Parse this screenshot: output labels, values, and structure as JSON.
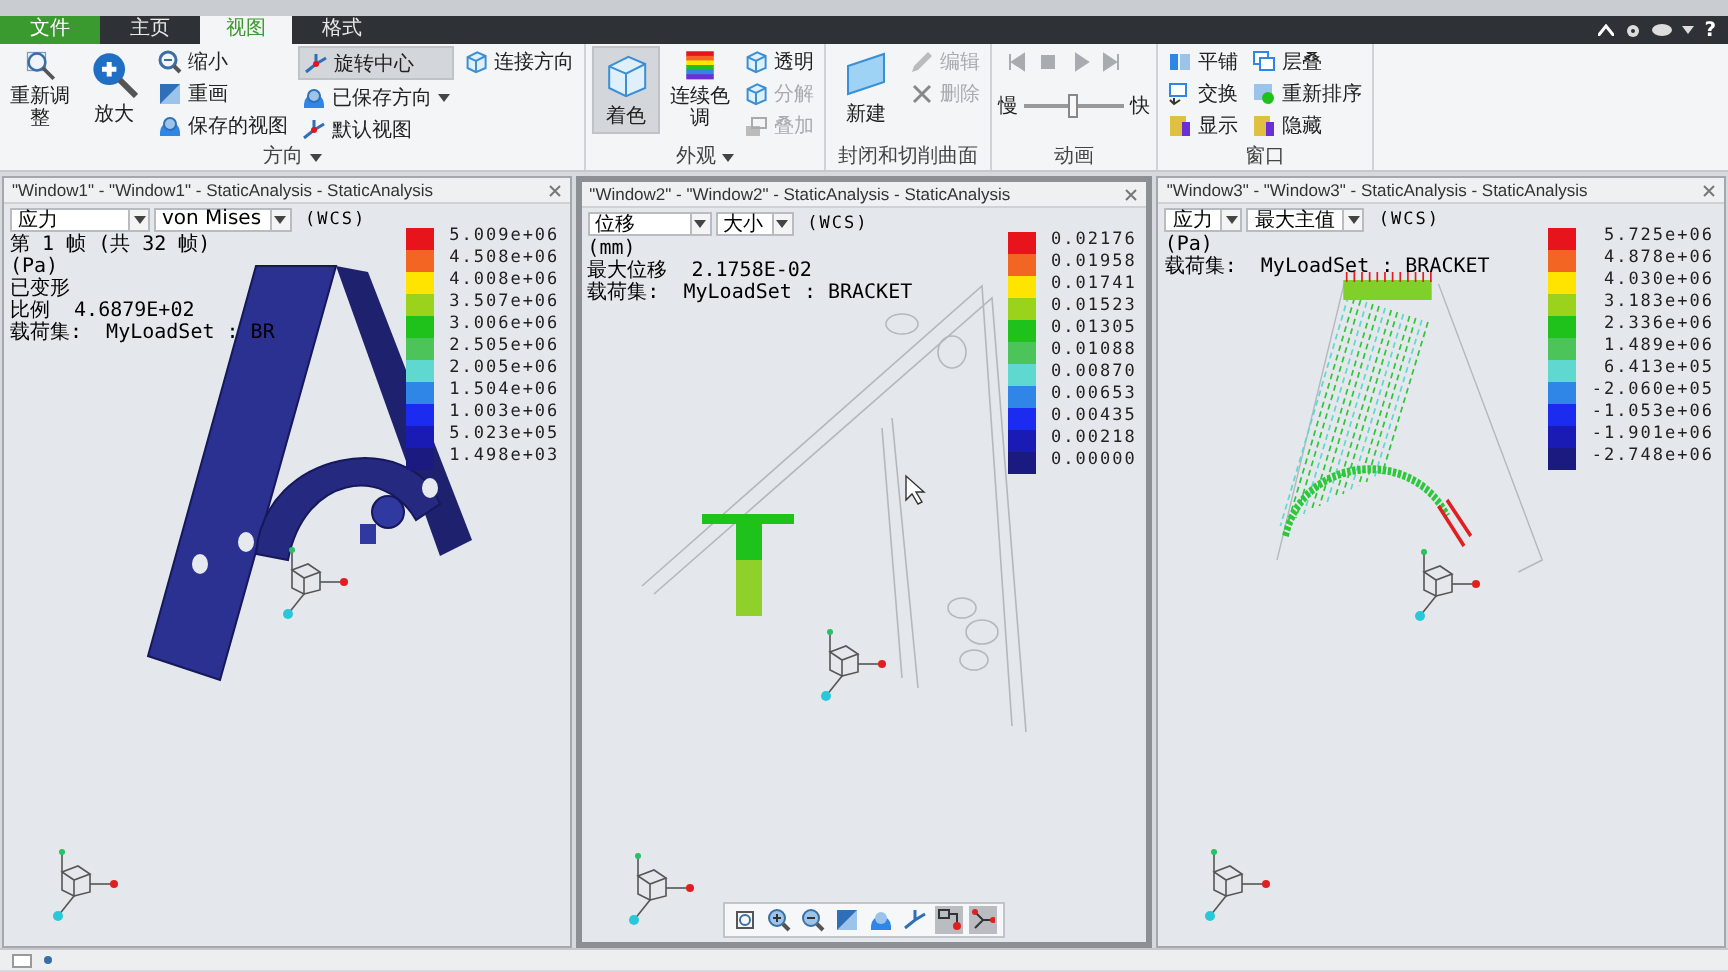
{
  "ribbon": {
    "tabs": [
      {
        "label": "文件",
        "kind": "file",
        "selected": false
      },
      {
        "label": "主页",
        "kind": "normal",
        "selected": false
      },
      {
        "label": "视图",
        "kind": "normal",
        "selected": true
      },
      {
        "label": "格式",
        "kind": "normal",
        "selected": false
      }
    ],
    "help": "?",
    "groups": [
      {
        "label": "方向",
        "has_menu": true,
        "columns": [
          [
            {
              "kind": "large",
              "label": "重新调整",
              "disabled": false,
              "selected": false
            }
          ],
          [
            {
              "kind": "large",
              "label": "放大",
              "disabled": false,
              "selected": false
            }
          ],
          [
            {
              "kind": "small",
              "label": "缩小",
              "disabled": false,
              "selected": false
            },
            {
              "kind": "small",
              "label": "重画",
              "disabled": false,
              "selected": false
            },
            {
              "kind": "small",
              "label": "保存的视图",
              "disabled": false,
              "selected": false
            }
          ],
          [
            {
              "kind": "small",
              "label": "旋转中心",
              "disabled": false,
              "selected": true
            },
            {
              "kind": "small",
              "label": "已保存方向",
              "disabled": false,
              "selected": false,
              "has_menu": true
            },
            {
              "kind": "small",
              "label": "默认视图",
              "disabled": false,
              "selected": false
            }
          ],
          [
            {
              "kind": "small",
              "label": "连接方向",
              "disabled": false,
              "selected": false
            }
          ]
        ]
      },
      {
        "label": "外观",
        "has_menu": true,
        "columns": [
          [
            {
              "kind": "large",
              "label": "着色",
              "disabled": false,
              "selected": true
            }
          ],
          [
            {
              "kind": "large",
              "label": "连续色调",
              "disabled": false,
              "selected": false
            }
          ],
          [
            {
              "kind": "small",
              "label": "透明",
              "disabled": false,
              "selected": false
            },
            {
              "kind": "small",
              "label": "分解",
              "disabled": true,
              "selected": false
            },
            {
              "kind": "small",
              "label": "叠加",
              "disabled": true,
              "selected": false
            }
          ]
        ]
      },
      {
        "label": "封闭和切削曲面",
        "has_menu": false,
        "columns": [
          [
            {
              "kind": "large",
              "label": "新建",
              "disabled": false,
              "selected": false
            }
          ],
          [
            {
              "kind": "small",
              "label": "编辑",
              "disabled": true,
              "selected": false
            },
            {
              "kind": "small",
              "label": "删除",
              "disabled": true,
              "selected": false
            }
          ]
        ]
      },
      {
        "label": "动画",
        "has_menu": false,
        "columns": [
          [
            {
              "kind": "playback",
              "buttons": [
                {
                  "disabled": true
                },
                {
                  "disabled": true
                },
                {
                  "disabled": true
                },
                {
                  "disabled": true
                }
              ]
            },
            {
              "kind": "slider",
              "min_label": "慢",
              "max_label": "快",
              "level": 0.5
            }
          ]
        ]
      },
      {
        "label": "窗口",
        "has_menu": false,
        "columns": [
          [
            {
              "kind": "small",
              "label": "平铺",
              "disabled": false,
              "selected": false
            },
            {
              "kind": "small",
              "label": "交换",
              "disabled": false,
              "selected": false
            },
            {
              "kind": "small",
              "label": "显示",
              "disabled": false,
              "selected": false
            }
          ],
          [
            {
              "kind": "small",
              "label": "层叠",
              "disabled": false,
              "selected": false
            },
            {
              "kind": "small",
              "label": "重新排序",
              "disabled": false,
              "selected": false
            },
            {
              "kind": "small",
              "label": "隐藏",
              "disabled": false,
              "selected": false
            }
          ]
        ]
      }
    ]
  },
  "color_scale": [
    {
      "color": "#e8141b"
    },
    {
      "color": "#f26522"
    },
    {
      "color": "#ffe400"
    },
    {
      "color": "#9bd21b"
    },
    {
      "color": "#1fc21a"
    },
    {
      "color": "#4cc45a"
    },
    {
      "color": "#5fd8d0"
    },
    {
      "color": "#2f86e6"
    },
    {
      "color": "#1b2cf0"
    },
    {
      "color": "#1a1ab5"
    },
    {
      "color": "#1a1a80"
    }
  ],
  "panes": [
    {
      "title": "\"Window1\" - \"Window1\" - StaticAnalysis - StaticAnalysis",
      "selected": false,
      "kind": "shaded",
      "quantity": "应力",
      "component": "von Mises",
      "coord": "(WCS)",
      "info": [
        {
          "label": "第 1 帧 (共 32 帧)"
        },
        {
          "label": "(Pa)"
        },
        {
          "label": "已变形"
        },
        {
          "label": "比例",
          "value": "4.6879E+02"
        },
        {
          "label": "载荷集:",
          "value": "MyLoadSet :  BR"
        }
      ],
      "legend": [
        "5.009e+06",
        "4.508e+06",
        "4.008e+06",
        "3.507e+06",
        "3.006e+06",
        "2.505e+06",
        "2.005e+06",
        "1.504e+06",
        "1.003e+06",
        "5.023e+05",
        "1.498e+03"
      ]
    },
    {
      "title": "\"Window2\" - \"Window2\" - StaticAnalysis - StaticAnalysis",
      "selected": true,
      "kind": "displacement",
      "quantity": "位移",
      "component": "大小",
      "coord": "(WCS)",
      "info": [
        {
          "label": "(mm)"
        },
        {
          "label": "最大位移",
          "value": "2.1758E-02"
        },
        {
          "label": "载荷集:",
          "value": "MyLoadSet :  BRACKET"
        }
      ],
      "legend": [
        "0.02176",
        "0.01958",
        "0.01741",
        "0.01523",
        "0.01305",
        "0.01088",
        "0.00870",
        "0.00653",
        "0.00435",
        "0.00218",
        "0.00000"
      ],
      "toolbar": [
        {
          "selected": false
        },
        {
          "selected": false
        },
        {
          "selected": false
        },
        {
          "selected": false
        },
        {
          "selected": false
        },
        {
          "selected": false
        },
        {
          "selected": true
        },
        {
          "selected": true
        }
      ]
    },
    {
      "title": "\"Window3\" - \"Window3\" - StaticAnalysis - StaticAnalysis",
      "selected": false,
      "kind": "vectors",
      "quantity": "应力",
      "component": "最大主值",
      "coord": "(WCS)",
      "info": [
        {
          "label": "(Pa)"
        },
        {
          "label": "载荷集:",
          "value": "MyLoadSet :  BRACKET"
        }
      ],
      "legend": [
        "5.725e+06",
        "4.878e+06",
        "4.030e+06",
        "3.183e+06",
        "2.336e+06",
        "1.489e+06",
        "6.413e+05",
        "-2.060e+05",
        "-1.053e+06",
        "-1.901e+06",
        "-2.748e+06"
      ]
    }
  ]
}
